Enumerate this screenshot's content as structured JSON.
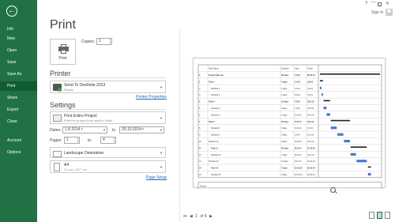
{
  "sidebar": {
    "back": "←",
    "items": [
      "Info",
      "New",
      "Open",
      "Save",
      "Save As",
      "Print",
      "Share",
      "Export",
      "Close",
      "Account",
      "Options"
    ],
    "active": "Print"
  },
  "titlebar": {
    "help": "?",
    "minimize": "—",
    "close": "✕",
    "signin": "Sign in"
  },
  "page": {
    "title": "Print"
  },
  "print_btn": {
    "label": "Print"
  },
  "copies": {
    "label": "Copies:",
    "value": "1"
  },
  "printer": {
    "section": "Printer",
    "name": "Send To OneNote 2013",
    "status": "Ready",
    "properties": "Printer Properties"
  },
  "settings": {
    "section": "Settings",
    "scope": {
      "main": "Print Entire Project",
      "sub": "Print the project from start to finish"
    },
    "dates": {
      "label": "Dates:",
      "from": "1.8.2014 г.",
      "to_label": "to",
      "to": "29.10.2014 г."
    },
    "pages": {
      "label": "Pages:",
      "from": "1",
      "to_label": "to",
      "to": "4"
    },
    "orientation": "Landscape Orientation",
    "paper": {
      "main": "A4",
      "sub": "21 cm x 29.7 cm"
    },
    "page_setup": "Page Setup"
  },
  "bottom": {
    "first": "⏮",
    "prev": "◀",
    "current": "1",
    "of": "of 4",
    "next": "▶"
  },
  "colors": {
    "accent": "#207245",
    "bar": "#4a78c8"
  },
  "preview": {
    "headers": [
      "",
      "Task Name",
      "Duration",
      "Start",
      "Finish"
    ],
    "footer_label": "Project",
    "footer_note": "Page 1",
    "rows": [
      [
        "0",
        "Project title row",
        "84 days",
        "1.8.14",
        "28.10.14"
      ],
      [
        "1",
        "Task 1",
        "4 days",
        "1.8.14",
        "6.8.14"
      ],
      [
        "2",
        "Subtask 2",
        "2 days",
        "1.8.14",
        "4.8.14"
      ],
      [
        "3",
        "Subtask 3",
        "2 days",
        "5.8.14",
        "6.8.14"
      ],
      [
        "4",
        "Task 4",
        "10 days",
        "7.8.14",
        "20.8.14"
      ],
      [
        "5",
        "Subtask 5",
        "5 days",
        "7.8.14",
        "13.8.14"
      ],
      [
        "6",
        "Subtask 6",
        "5 days",
        "14.8.14",
        "20.8.14"
      ],
      [
        "7",
        "Task 7",
        "25 days",
        "21.8.14",
        "24.9.14"
      ],
      [
        "8",
        "Subtask 8",
        "8 days",
        "21.8.14",
        "1.9.14"
      ],
      [
        "9",
        "Subtask 9",
        "9 days",
        "2.9.14",
        "12.9.14"
      ],
      [
        "10",
        "Subtask 10",
        "8 days",
        "15.9.14",
        "24.9.14"
      ],
      [
        "11",
        "Task 11",
        "20 days",
        "25.9.14",
        "22.10.14"
      ],
      [
        "12",
        "Subtask 12",
        "7 days",
        "25.9.14",
        "3.10.14"
      ],
      [
        "13",
        "Subtask 13",
        "13 days",
        "6.10.14",
        "22.10.14"
      ],
      [
        "14",
        "Task 14",
        "4 days",
        "23.10.14",
        "28.10.14"
      ],
      [
        "15",
        "Subtask 15",
        "4 days",
        "23.10.14",
        "28.10.14"
      ]
    ]
  }
}
